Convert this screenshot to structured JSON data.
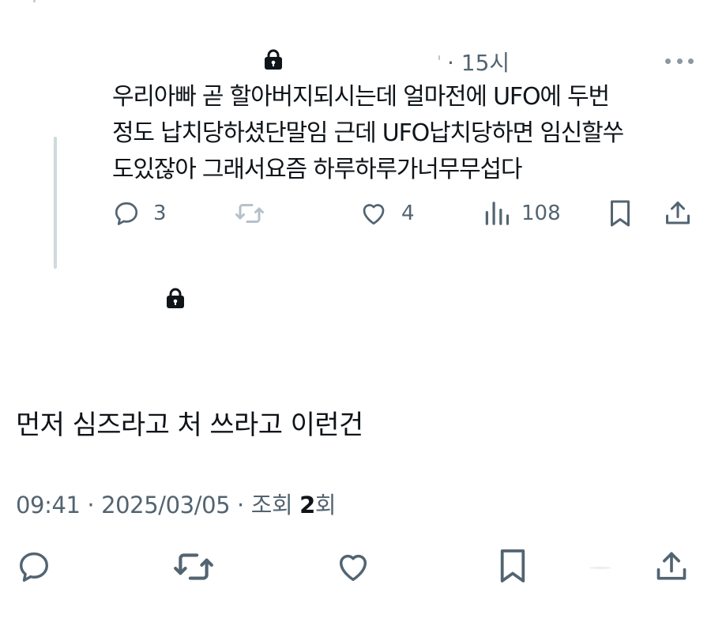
{
  "reply": {
    "time": "· 15시",
    "text_lines": [
      "우리아빠 곧 할아버지되시는데 얼마전에 UFO에 두번",
      "정도 납치당하셨단말임 근데 UFO납치당하면 임신할쑤",
      "도있잖아 그래서요즘 하루하루가너무무섭다"
    ],
    "actions": {
      "reply_count": "3",
      "retweet_count": "",
      "like_count": "4",
      "views_count": "108"
    }
  },
  "main": {
    "text": "먼저 심즈라고 처 쓰라고 이런건",
    "meta": {
      "time": "09:41",
      "sep1": "·",
      "date": "2025/03/05",
      "sep2": "·",
      "views_prefix": "조회",
      "views_count": "2",
      "views_suffix": "회"
    }
  },
  "colors": {
    "text": "#0f1419",
    "secondary": "#536471",
    "thread_line": "#cfd9de"
  },
  "icons": [
    "lock-icon",
    "more-icon",
    "reply-icon",
    "retweet-icon",
    "like-icon",
    "views-icon",
    "bookmark-icon",
    "share-icon"
  ]
}
